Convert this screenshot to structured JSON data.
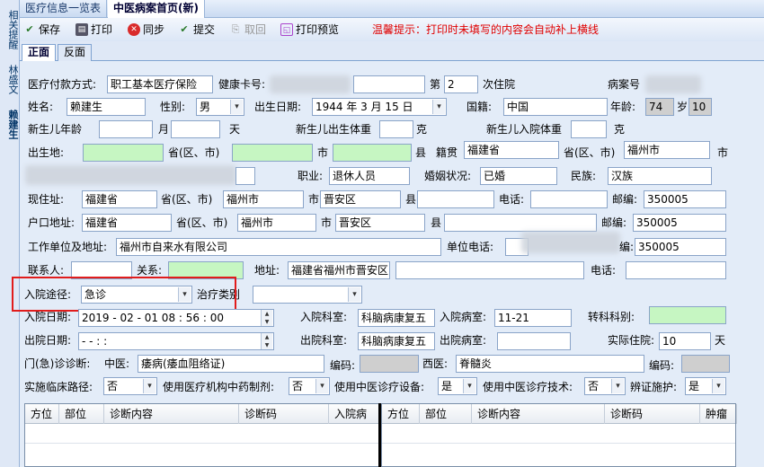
{
  "sidetabs": [
    "相关提醒",
    "林盛文",
    "",
    "赖建生"
  ],
  "doctabs": {
    "tab1": "医疗信息一览表",
    "tab2": "中医病案首页(新)"
  },
  "toolbar": {
    "save": "保存",
    "print": "打印",
    "sync": "同步",
    "submit": "提交",
    "cancel": "取回",
    "preview": "打印预览",
    "tip": "温馨提示：打印时未填写的内容会自动补上横线"
  },
  "pagetabs": {
    "front": "正面",
    "back": "反面"
  },
  "labels": {
    "payment": "医疗付款方式:",
    "healthcard": "健康卡号:",
    "di": "第",
    "admit_times": "次住院",
    "record_no": "病案号",
    "name": "姓名:",
    "sex": "性别:",
    "birth": "出生日期:",
    "country": "国籍:",
    "age": "年龄:",
    "sui": "岁",
    "nb_age": "新生儿年龄",
    "month": "月",
    "day": "天",
    "nb_birth_wt": "新生儿出生体重",
    "g1": "克",
    "nb_adm_wt": "新生儿入院体重",
    "g2": "克",
    "birthplace": "出生地:",
    "prov1": "省(区、市)",
    "city1": "市",
    "county1": "县",
    "native": "籍贯",
    "prov2": "省(区、市)",
    "city2": "市",
    "job": "职业:",
    "marital": "婚姻状况:",
    "ethnic": "民族:",
    "cur_addr": "现住址:",
    "prov3": "省(区、市)",
    "city3": "市",
    "county3": "县",
    "phone1": "电话:",
    "zip1": "邮编:",
    "reg_addr": "户口地址:",
    "prov4": "省(区、市)",
    "city4": "市",
    "county4": "县",
    "zip2": "邮编:",
    "work": "工作单位及地址:",
    "work_phone": "单位电话:",
    "zip3": "编:",
    "contact": "联系人:",
    "relation": "关系:",
    "address": "地址:",
    "phone2": "电话:",
    "adm_route": "入院途径:",
    "treat_type": "治疗类别",
    "adm_date": "入院日期:",
    "adm_dept": "入院科室:",
    "adm_ward": "入院病室:",
    "transfer": "转科科别:",
    "dis_date": "出院日期:",
    "dis_dept": "出院科室:",
    "dis_ward": "出院病室:",
    "stay": "实际住院:",
    "stay_unit": "天",
    "op_diag": "门(急)诊诊断:",
    "tcm": "中医:",
    "code1": "编码:",
    "wm": "西医:",
    "code2": "编码:",
    "pathway": "实施临床路径:",
    "tcm_drug": "使用医疗机构中药制剂:",
    "tcm_equip": "使用中医诊疗设备:",
    "tcm_tech": "使用中医诊疗技术:",
    "syndrome": "辨证施护:"
  },
  "values": {
    "payment": "职工基本医疗保险",
    "admit_times": "2",
    "name": "赖建生",
    "sex": "男",
    "birth": "1944 年 3 月 15 日",
    "country": "中国",
    "age": "74",
    "age_month": "10",
    "native_prov": "福建省",
    "native_city": "福州市",
    "job": "退休人员",
    "marital": "已婚",
    "ethnic": "汉族",
    "cur_prov": "福建省",
    "cur_city": "福州市",
    "cur_county": "晋安区",
    "cur_zip": "350005",
    "reg_prov": "福建省",
    "reg_city": "福州市",
    "reg_county": "晋安区",
    "reg_zip": "350005",
    "work": "福州市自来水有限公司",
    "work_zip": "350005",
    "contact_addr": "福建省福州市晋安区",
    "adm_route": "急诊",
    "adm_date": "2019 - 02 - 01   08 : 56 : 00",
    "adm_dept": "科脑病康复五",
    "adm_ward": "11-21",
    "dis_date": "-    -         :    :",
    "dis_dept": "科脑病康复五",
    "stay": "10",
    "tcm_diag": "痿病(痿血阻络证)",
    "wm_diag": "脊髓炎",
    "pathway": "否",
    "tcm_drug": "否",
    "tcm_equip": "是",
    "tcm_tech": "否",
    "syndrome": "是"
  },
  "grid_left": [
    "方位",
    "部位",
    "诊断内容",
    "诊断码",
    "入院病"
  ],
  "grid_right": [
    "方位",
    "部位",
    "诊断内容",
    "诊断码",
    "肿瘤"
  ]
}
